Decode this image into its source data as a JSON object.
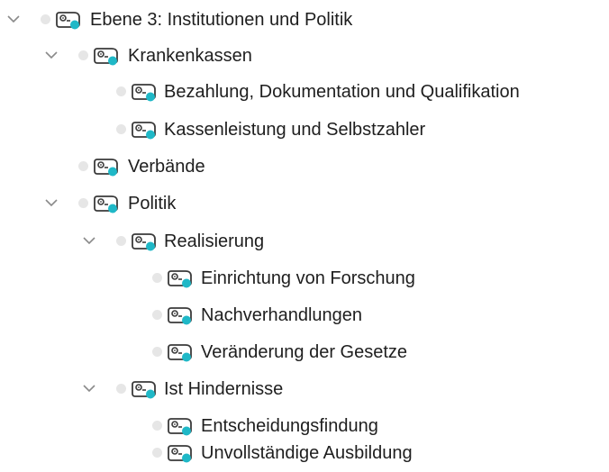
{
  "colors": {
    "chevron": "#8a8a8a",
    "bullet": "#e6e6e6",
    "icon_outline": "#3a3a3a",
    "icon_dot": "#1fb8c7"
  },
  "tree": {
    "nodes": [
      {
        "label": "Ebene 3:  Institutionen und Politik",
        "expandable": true,
        "expanded": true,
        "icon": "code-icon"
      },
      {
        "label": "Krankenkassen",
        "expandable": true,
        "expanded": true,
        "icon": "code-icon"
      },
      {
        "label": "Bezahlung, Dokumentation und  Qualifikation",
        "expandable": false,
        "icon": "code-icon"
      },
      {
        "label": "Kassenleistung und Selbstzahler",
        "expandable": false,
        "icon": "code-icon"
      },
      {
        "label": "Verbände",
        "expandable": false,
        "icon": "code-icon"
      },
      {
        "label": "Politik",
        "expandable": true,
        "expanded": true,
        "icon": "code-icon"
      },
      {
        "label": "Realisierung",
        "expandable": true,
        "expanded": true,
        "icon": "code-icon"
      },
      {
        "label": "Einrichtung von Forschung",
        "expandable": false,
        "icon": "code-icon"
      },
      {
        "label": "Nachverhandlungen",
        "expandable": false,
        "icon": "code-icon"
      },
      {
        "label": "Veränderung der Gesetze",
        "expandable": false,
        "icon": "code-icon"
      },
      {
        "label": "Ist Hindernisse",
        "expandable": true,
        "expanded": true,
        "icon": "code-icon"
      },
      {
        "label": "Entscheidungsfindung",
        "expandable": false,
        "icon": "code-icon"
      },
      {
        "label": "Unvollständige Ausbildung",
        "expandable": false,
        "icon": "code-icon"
      }
    ]
  }
}
